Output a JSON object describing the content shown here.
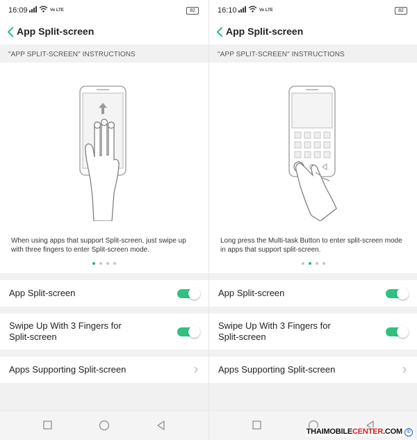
{
  "screens": [
    {
      "status_time": "16:09",
      "network_label": "Vo LTE",
      "battery_level": "82",
      "header_title": "App Split-screen",
      "section_header": "\"APP SPLIT-SCREEN\" INSTRUCTIONS",
      "illustration_icon": "three-finger-swipe-up",
      "instruction_text": "When using apps that support Split-screen, just swipe up with three fingers to enter Split-screen mode.",
      "page_indicator": {
        "count": 4,
        "active_index": 0
      },
      "settings": {
        "app_split_label": "App Split-screen",
        "app_split_enabled": true,
        "swipe_label_line1": "Swipe Up With 3 Fingers for",
        "swipe_label_line2": "Split-screen",
        "swipe_enabled": true,
        "apps_supporting_label": "Apps Supporting Split-screen"
      }
    },
    {
      "status_time": "16:10",
      "network_label": "Vo LTE",
      "battery_level": "82",
      "header_title": "App Split-screen",
      "section_header": "\"APP SPLIT-SCREEN\" INSTRUCTIONS",
      "illustration_icon": "long-press-multitask-button",
      "instruction_text": "Long press the Multi-task Button to enter split-screen mode in apps that support split-screen.",
      "page_indicator": {
        "count": 4,
        "active_index": 1
      },
      "settings": {
        "app_split_label": "App Split-screen",
        "app_split_enabled": true,
        "swipe_label_line1": "Swipe Up With 3 Fingers for",
        "swipe_label_line2": "Split-screen",
        "swipe_enabled": true,
        "apps_supporting_label": "Apps Supporting Split-screen"
      }
    }
  ],
  "nav_icons": [
    "square-recents-icon",
    "circle-home-icon",
    "triangle-back-icon"
  ],
  "colors": {
    "accent": "#2ec27e",
    "indicator_active": "#34b177",
    "background": "#f1f1f1"
  },
  "watermark": {
    "part1": "THAIMOBILE",
    "part2": "CENTER",
    "part3": ".COM",
    "symbol": "©"
  }
}
